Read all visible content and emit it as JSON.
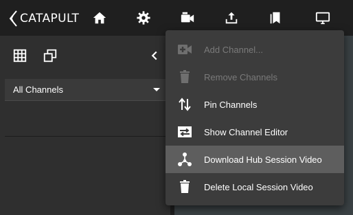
{
  "app": {
    "brand": "CATAPULT"
  },
  "topbar": {
    "icons": [
      "home-icon",
      "settings-icon",
      "video-camera-icon",
      "upload-icon",
      "bookmarks-icon",
      "monitor-icon"
    ]
  },
  "sidebar": {
    "channel_filter": {
      "selected": "All Channels"
    }
  },
  "menu": {
    "items": [
      {
        "label": "Add Channel...",
        "icon": "add-channel-icon",
        "disabled": true
      },
      {
        "label": "Remove Channels",
        "icon": "trash-icon",
        "disabled": true
      },
      {
        "label": "Pin Channels",
        "icon": "swap-vertical-icon",
        "disabled": false
      },
      {
        "label": "Show Channel Editor",
        "icon": "channel-editor-icon",
        "disabled": false
      },
      {
        "label": "Download Hub Session Video",
        "icon": "hub-icon",
        "disabled": false,
        "highlighted": true
      },
      {
        "label": "Delete Local Session Video",
        "icon": "trash-icon",
        "disabled": false
      }
    ]
  },
  "colors": {
    "topbar_bg": "#1f1f1f",
    "sidebar_bg": "#2f2f2f",
    "menu_bg": "#3c3c3c",
    "menu_highlight": "#5e5e5e",
    "disabled_text": "#7a7a7a"
  }
}
